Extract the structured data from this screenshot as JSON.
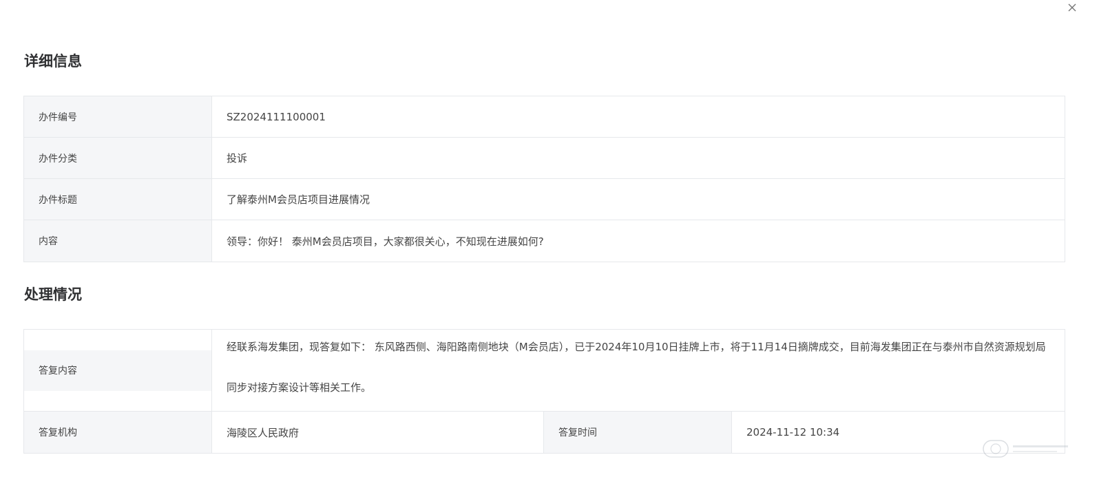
{
  "details": {
    "title": "详细信息",
    "fields": [
      {
        "label": "办件编号",
        "value": "SZ2024111100001"
      },
      {
        "label": "办件分类",
        "value": "投诉"
      },
      {
        "label": "办件标题",
        "value": "了解泰州M会员店项目进展情况"
      },
      {
        "label": "内容",
        "value": "领导：你好！ 泰州M会员店项目，大家都很关心，不知现在进展如何?"
      }
    ]
  },
  "processing": {
    "title": "处理情况",
    "reply_content_label": "答复内容",
    "reply_content": "经联系海发集团，现答复如下： 东风路西侧、海阳路南侧地块（M会员店），已于2024年10月10日挂牌上市，将于11月14日摘牌成交，目前海发集团正在与泰州市自然资源规划局同步对接方案设计等相关工作。",
    "reply_org_label": "答复机构",
    "reply_org": "海陵区人民政府",
    "reply_time_label": "答复时间",
    "reply_time": "2024-11-12 10:34"
  },
  "icons": {
    "close": "close-icon",
    "watermark": "watermark-logo"
  },
  "colors": {
    "label_bg": "#f5f6f8",
    "border": "#e6e8eb",
    "text": "#444444",
    "title": "#303133"
  }
}
